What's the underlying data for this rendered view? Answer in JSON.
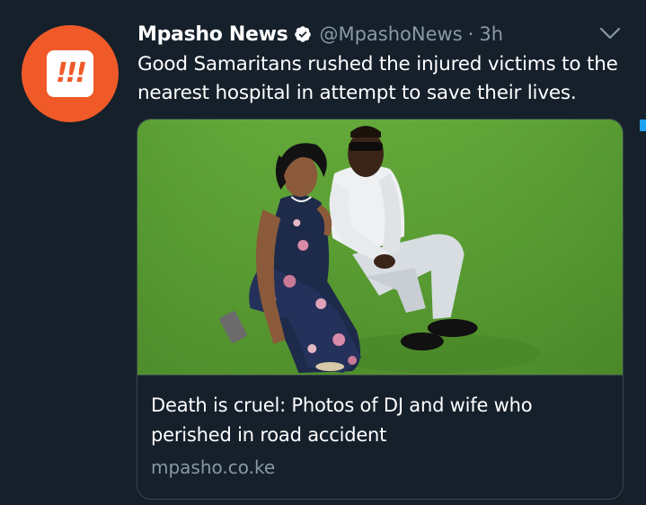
{
  "author": {
    "name": "Mpasho News",
    "handle": "@MpashoNews",
    "separator": "·",
    "time": "3h",
    "avatar_icon": "mpasho-logo-icon",
    "avatar_mark": "!!!",
    "verified_icon": "verified-badge-icon"
  },
  "tweet": {
    "text": "Good Samaritans rushed the injured victims to the nearest hospital in attempt to save their lives."
  },
  "card": {
    "image_icon": "couple-photo",
    "title": "Death is cruel: Photos of DJ and wife who perished in road accident",
    "domain": "mpasho.co.ke"
  },
  "menu": {
    "icon": "chevron-down-icon"
  },
  "colors": {
    "background": "#15202b",
    "secondary_text": "#8899a6",
    "border": "#38444d",
    "brand": "#f05a28",
    "accent": "#1da1f2"
  }
}
